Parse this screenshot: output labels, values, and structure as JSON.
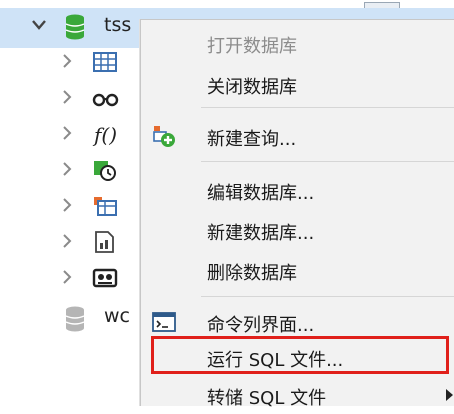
{
  "tree": {
    "root_label": "tss",
    "child_icons": [
      "table-icon",
      "view-icon",
      "function-icon",
      "event-icon",
      "query-icon",
      "report-icon",
      "backup-icon"
    ],
    "second_db_label": "wc"
  },
  "menu": {
    "items": [
      {
        "label": "打开数据库",
        "enabled": false
      },
      {
        "label": "关闭数据库",
        "enabled": true
      },
      {
        "label": "新建查询...",
        "enabled": true,
        "icon": "new-query-icon"
      },
      {
        "label": "编辑数据库...",
        "enabled": true
      },
      {
        "label": "新建数据库...",
        "enabled": true
      },
      {
        "label": "删除数据库",
        "enabled": true
      },
      {
        "label": "命令列界面...",
        "enabled": true,
        "icon": "console-icon"
      },
      {
        "label": "运行 SQL 文件...",
        "enabled": true,
        "highlighted": true
      },
      {
        "label": "转储 SQL 文件",
        "enabled": true,
        "submenu": true
      }
    ]
  },
  "colors": {
    "selection": "#cfe3f7",
    "menu_bg": "#f2f2f2",
    "highlight": "#e0201b",
    "db_green": "#3aa83a"
  }
}
